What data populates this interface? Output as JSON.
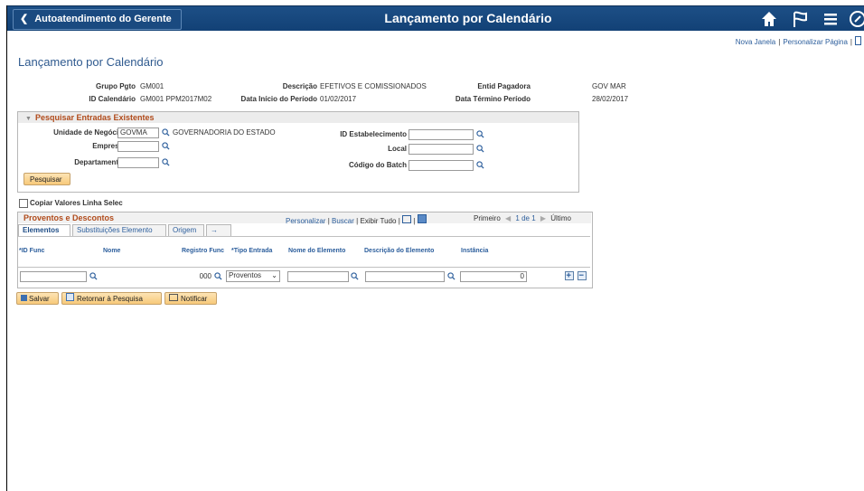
{
  "header": {
    "back_label": "Autoatendimento do Gerente",
    "page_title": "Lançamento por Calendário"
  },
  "toplinks": {
    "new_window": "Nova Janela",
    "personalize_page": "Personalizar Página"
  },
  "page": {
    "title": "Lançamento por Calendário",
    "fields": {
      "grupo_pgto_label": "Grupo Pgto",
      "grupo_pgto_value": "GM001",
      "id_calendario_label": "ID Calendário",
      "id_calendario_value": "GM001 PPM2017M02",
      "descricao_label": "Descrição",
      "descricao_value": "EFETIVOS E COMISSIONADOS",
      "data_inicio_label": "Data Início do Período",
      "data_inicio_value": "01/02/2017",
      "entid_label": "Entid Pagadora",
      "entid_value": "GOV MAR",
      "data_termino_label": "Data Término Período",
      "data_termino_value": "28/02/2017"
    }
  },
  "search": {
    "title": "Pesquisar Entradas Existentes",
    "unidade_label": "Unidade de Negócio",
    "unidade_value": "GOVMA",
    "unidade_desc": "GOVERNADORIA DO ESTADO",
    "empresa_label": "Empresa",
    "empresa_value": "",
    "departamento_label": "Departamento",
    "departamento_value": "",
    "id_estab_label": "ID Estabelecimento",
    "id_estab_value": "",
    "local_label": "Local",
    "local_value": "",
    "batch_label": "Código do Batch",
    "batch_value": "",
    "button": "Pesquisar"
  },
  "copy_label": "Copiar Valores Linha Selec",
  "grid": {
    "title": "Proventos e Descontos",
    "personalize": "Personalizar",
    "buscar": "Buscar",
    "exibir": "Exibir Tudo",
    "first": "Primeiro",
    "range": "1 de 1",
    "last": "Último",
    "tabs": [
      "Elementos",
      "Substituições Elemento",
      "Origem"
    ],
    "columns": [
      "*ID Func",
      "Nome",
      "Registro Func",
      "*Tipo Entrada",
      "Nome do Elemento",
      "Descrição do Elemento",
      "Instância"
    ],
    "row": {
      "id_func": "",
      "registro": "000",
      "tipo": "Proventos",
      "nome_elem": "",
      "desc_elem": "",
      "instancia": "0"
    }
  },
  "bottom": {
    "save": "Salvar",
    "return": "Retornar à Pesquisa",
    "notify": "Notificar"
  }
}
